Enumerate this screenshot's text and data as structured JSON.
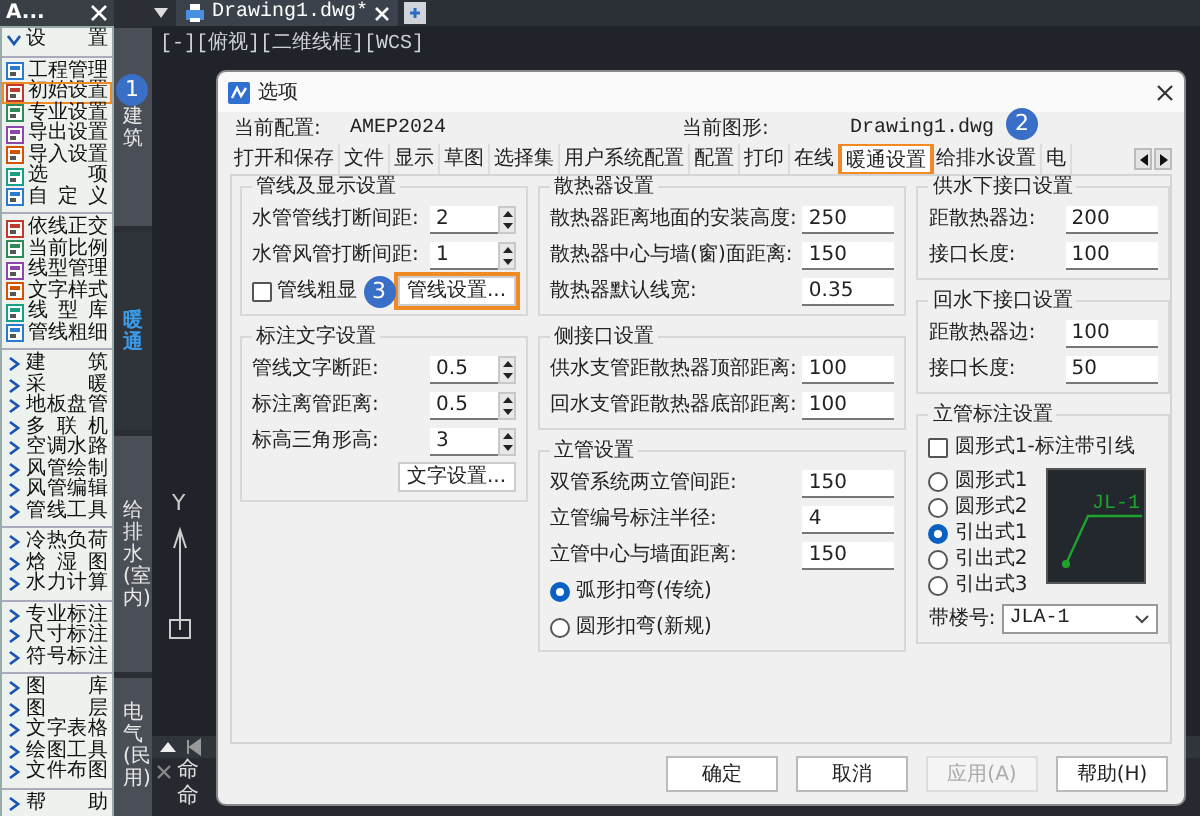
{
  "sidebar": {
    "title": "A...",
    "header": {
      "label": "设 置",
      "expanded": true
    },
    "groups": [
      [
        {
          "kind": "tool",
          "label": "工程管理",
          "highlighted": false
        },
        {
          "kind": "tool",
          "label": "初始设置",
          "highlighted": true,
          "callout": "1"
        },
        {
          "kind": "tool",
          "label": "专业设置",
          "highlighted": false
        },
        {
          "kind": "tool",
          "label": "导出设置",
          "highlighted": false
        },
        {
          "kind": "tool",
          "label": "导入设置",
          "highlighted": false
        },
        {
          "kind": "tool",
          "label": "选 项",
          "highlighted": false
        },
        {
          "kind": "tool",
          "label": "自 定 义",
          "highlighted": false
        }
      ],
      [
        {
          "kind": "tool",
          "label": "依线正交",
          "highlighted": false
        },
        {
          "kind": "tool",
          "label": "当前比例",
          "highlighted": false
        },
        {
          "kind": "tool",
          "label": "线型管理",
          "highlighted": false
        },
        {
          "kind": "tool",
          "label": "文字样式",
          "highlighted": false
        },
        {
          "kind": "tool",
          "label": "线 型 库",
          "highlighted": false
        },
        {
          "kind": "tool",
          "label": "管线粗细",
          "highlighted": false
        }
      ],
      [
        {
          "kind": "menu",
          "label": "建 筑",
          "expanded": false
        },
        {
          "kind": "menu",
          "label": "采 暖",
          "expanded": false
        },
        {
          "kind": "menu",
          "label": "地板盘管",
          "expanded": false
        },
        {
          "kind": "menu",
          "label": "多 联 机",
          "expanded": false
        },
        {
          "kind": "menu",
          "label": "空调水路",
          "expanded": false
        },
        {
          "kind": "menu",
          "label": "风管绘制",
          "expanded": false
        },
        {
          "kind": "menu",
          "label": "风管编辑",
          "expanded": false
        },
        {
          "kind": "menu",
          "label": "管线工具",
          "expanded": false
        }
      ],
      [
        {
          "kind": "menu",
          "label": "冷热负荷",
          "expanded": false
        },
        {
          "kind": "menu",
          "label": "焓 湿 图",
          "expanded": false
        },
        {
          "kind": "menu",
          "label": "水力计算",
          "expanded": false
        }
      ],
      [
        {
          "kind": "menu",
          "label": "专业标注",
          "expanded": false
        },
        {
          "kind": "menu",
          "label": "尺寸标注",
          "expanded": false
        },
        {
          "kind": "menu",
          "label": "符号标注",
          "expanded": false
        }
      ],
      [
        {
          "kind": "menu",
          "label": "图 库",
          "expanded": false
        },
        {
          "kind": "menu",
          "label": "图 层",
          "expanded": false
        },
        {
          "kind": "menu",
          "label": "文字表格",
          "expanded": false
        },
        {
          "kind": "menu",
          "label": "绘图工具",
          "expanded": false
        },
        {
          "kind": "menu",
          "label": "文件布图",
          "expanded": false
        }
      ],
      [
        {
          "kind": "menu",
          "label": "帮 助",
          "expanded": false
        }
      ]
    ]
  },
  "side_tabs": [
    {
      "label": "建筑",
      "selected": false
    },
    {
      "label": "暖通",
      "selected": true
    },
    {
      "label": "给排水(室内)",
      "selected": false
    },
    {
      "label": "电气(民用)",
      "selected": false
    }
  ],
  "cad": {
    "doc_tabs": [
      {
        "label": "Drawing1.dwg*",
        "selected": true
      }
    ],
    "viewport_label": "[-][俯视][二维线框][WCS]",
    "axis_label": "Y",
    "command_lines": [
      "命",
      "命"
    ]
  },
  "dialog": {
    "title": "选项",
    "info": [
      {
        "label": "当前配置:",
        "value": "AMEP2024"
      },
      {
        "label": "当前图形:",
        "value": "Drawing1.dwg"
      }
    ],
    "tabs": [
      {
        "label": "打开和保存",
        "selected": false
      },
      {
        "label": "文件",
        "selected": false
      },
      {
        "label": "显示",
        "selected": false
      },
      {
        "label": "草图",
        "selected": false
      },
      {
        "label": "选择集",
        "selected": false
      },
      {
        "label": "用户系统配置",
        "selected": false
      },
      {
        "label": "配置",
        "selected": false
      },
      {
        "label": "打印",
        "selected": false
      },
      {
        "label": "在线",
        "selected": false
      },
      {
        "label": "暖通设置",
        "selected": true,
        "highlighted": true,
        "callout": "2"
      },
      {
        "label": "给排水设置",
        "selected": false
      },
      {
        "label": "电",
        "selected": false
      }
    ],
    "columns": [
      [
        {
          "title": "管线及显示设置",
          "rows": [
            {
              "kind": "spin",
              "label": "水管管线打断间距:",
              "value": "2"
            },
            {
              "kind": "spin",
              "label": "水管风管打断间距:",
              "value": "1"
            },
            {
              "kind": "check_button",
              "label": "管线粗显",
              "checked": false,
              "button": "管线设置...",
              "highlighted": true,
              "callout": "3"
            }
          ]
        },
        {
          "title": "标注文字设置",
          "rows": [
            {
              "kind": "spin",
              "label": "管线文字断距:",
              "value": "0.5"
            },
            {
              "kind": "spin",
              "label": "标注离管距离:",
              "value": "0.5"
            },
            {
              "kind": "spin",
              "label": "标高三角形高:",
              "value": "3"
            },
            {
              "kind": "button",
              "label": "文字设置..."
            }
          ]
        }
      ],
      [
        {
          "title": "散热器设置",
          "rows": [
            {
              "kind": "input",
              "label": "散热器距离地面的安装高度:",
              "value": "250"
            },
            {
              "kind": "input",
              "label": "散热器中心与墙(窗)面距离:",
              "value": "150"
            },
            {
              "kind": "input",
              "label": "散热器默认线宽:",
              "value": "0.35"
            }
          ]
        },
        {
          "title": "侧接口设置",
          "rows": [
            {
              "kind": "input",
              "label": "供水支管距散热器顶部距离:",
              "value": "100"
            },
            {
              "kind": "input",
              "label": "回水支管距散热器底部距离:",
              "value": "100"
            }
          ]
        },
        {
          "title": "立管设置",
          "rows": [
            {
              "kind": "input",
              "label": "双管系统两立管间距:",
              "value": "150"
            },
            {
              "kind": "input",
              "label": "立管编号标注半径:",
              "value": "4"
            },
            {
              "kind": "input",
              "label": "立管中心与墙面距离:",
              "value": "150"
            },
            {
              "kind": "radio",
              "label": "弧形扣弯(传统)",
              "selected": true
            },
            {
              "kind": "radio",
              "label": "圆形扣弯(新规)",
              "selected": false
            }
          ]
        }
      ],
      [
        {
          "title": "供水下接口设置",
          "rows": [
            {
              "kind": "input",
              "label": "距散热器边:",
              "value": "200"
            },
            {
              "kind": "input",
              "label": "接口长度:",
              "value": "100"
            }
          ]
        },
        {
          "title": "回水下接口设置",
          "rows": [
            {
              "kind": "input",
              "label": "距散热器边:",
              "value": "100"
            },
            {
              "kind": "input",
              "label": "接口长度:",
              "value": "50"
            }
          ]
        },
        {
          "title": "立管标注设置",
          "rows": [
            {
              "kind": "checkbox",
              "label": "圆形式1-标注带引线",
              "checked": false
            },
            {
              "kind": "radio_preview",
              "options": [
                {
                  "label": "圆形式1",
                  "selected": false
                },
                {
                  "label": "圆形式2",
                  "selected": false
                },
                {
                  "label": "引出式1",
                  "selected": true
                },
                {
                  "label": "引出式2",
                  "selected": false
                },
                {
                  "label": "引出式3",
                  "selected": false
                }
              ],
              "preview_label": "JL-1"
            },
            {
              "kind": "select",
              "label": "带楼号:",
              "value": "JLA-1"
            }
          ]
        }
      ]
    ],
    "buttons": [
      {
        "label": "确定",
        "disabled": false
      },
      {
        "label": "取消",
        "disabled": false
      },
      {
        "label": "应用(A)",
        "disabled": true
      },
      {
        "label": "帮助(H)",
        "disabled": false
      }
    ]
  }
}
